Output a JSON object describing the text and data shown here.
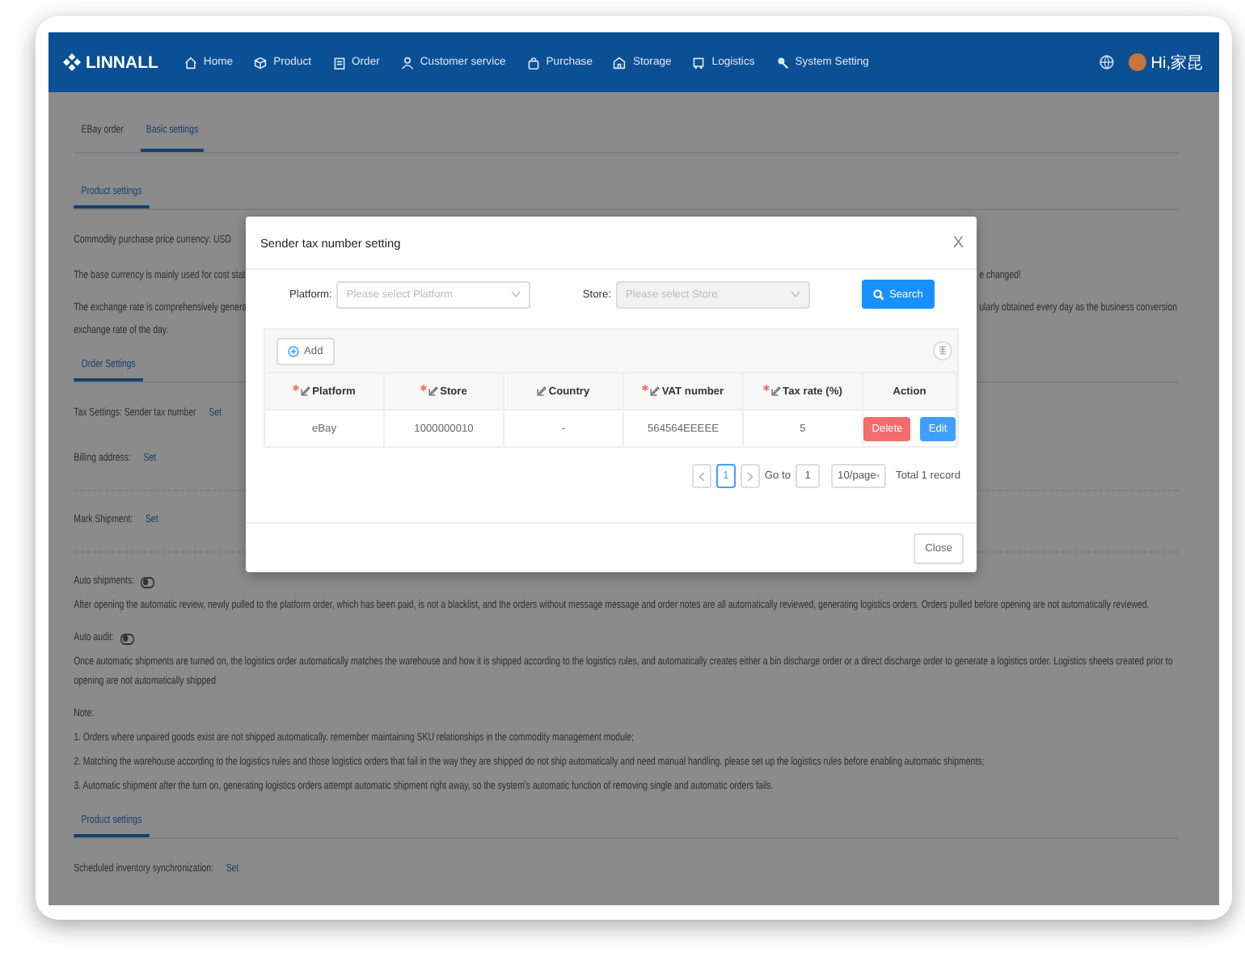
{
  "nav": {
    "logo": "LINNALL",
    "items": [
      {
        "label": "Home"
      },
      {
        "label": "Product"
      },
      {
        "label": "Order"
      },
      {
        "label": "Customer service"
      },
      {
        "label": "Purchase"
      },
      {
        "label": "Storage"
      },
      {
        "label": "Logistics"
      },
      {
        "label": "System Setting"
      }
    ],
    "user": "Hi,家昆"
  },
  "tabs": [
    {
      "label": "EBay order",
      "selected": false
    },
    {
      "label": "Basic settings",
      "selected": true
    }
  ],
  "blocks": [
    {
      "kind": "section",
      "title": "Product settings"
    },
    {
      "kind": "line",
      "left": "Commodity purchase price currency:  USD"
    },
    {
      "kind": "line",
      "left": "The base currency is mainly used for cost stat",
      "right": "e changed!"
    },
    {
      "kind": "line",
      "left": "The exchange rate is comprehensively genera",
      "right": "ularly obtained every day as the business conversion"
    },
    {
      "kind": "line",
      "left": "exchange rate of the day."
    },
    {
      "kind": "section",
      "title": "Order Settings"
    },
    {
      "kind": "setting",
      "label": "Tax Settings:  Sender tax number",
      "link": "Set"
    },
    {
      "kind": "setting",
      "label": "Billing address:",
      "link": "Set"
    },
    {
      "kind": "setting",
      "label": "Mark Shipment:",
      "link": "Set"
    },
    {
      "kind": "toggle",
      "label": "Auto shipments:",
      "on": false,
      "text": "After opening the automatic review, newly pulled to the platform order, which has been paid, is not a blacklist, and the orders without message message and order notes are all automatically reviewed, generating logistics orders. Orders pulled before opening are not automatically reviewed."
    },
    {
      "kind": "toggle",
      "label": "Auto audit:",
      "on": false,
      "text": "Once automatic shipments are turned on, the logistics order automatically matches the warehouse and how it is shipped according to the logistics rules, and automatically creates either a bin discharge order or a direct discharge order to generate a logistics order. Logistics sheets created prior to opening are not automatically shipped"
    },
    {
      "kind": "line",
      "left": "Note:"
    },
    {
      "kind": "line",
      "left": "1. Orders where unpaired goods exist are not shipped automatically. remember maintaining SKU relationships in the commodity management module;"
    },
    {
      "kind": "line",
      "left": "2. Matching the warehouse according to the logistics rules and those logistics orders that fail in the way they are shipped do not ship automatically and need manual handling. please set up the logistics rules before enabling automatic shipments;"
    },
    {
      "kind": "line",
      "left": "3. Automatic shipment after the turn on, generating logistics orders attempt automatic shipment right away, so the system's automatic function of removing single and automatic orders fails."
    },
    {
      "kind": "section",
      "title": "Product settings"
    },
    {
      "kind": "setting",
      "label": "Scheduled inventory synchronization:",
      "link": "Set"
    }
  ],
  "modal": {
    "title": "Sender tax number setting",
    "close": "X",
    "filters": [
      {
        "label": "Platform:",
        "placeholder": "Please select Platform",
        "disabled": false
      },
      {
        "label": "Store:",
        "placeholder": "Please select Store",
        "disabled": true
      }
    ],
    "search_button": "Search",
    "add_button": "Add",
    "columns": [
      {
        "label": "Platform",
        "required": true,
        "editable": true
      },
      {
        "label": "Store",
        "required": true,
        "editable": true
      },
      {
        "label": "Country",
        "required": false,
        "editable": true
      },
      {
        "label": "VAT number",
        "required": true,
        "editable": true
      },
      {
        "label": "Tax rate (%)",
        "required": true,
        "editable": true
      },
      {
        "label": "Action",
        "required": false,
        "editable": false
      }
    ],
    "rows": [
      {
        "cells": [
          "eBay",
          "1000000010",
          "-",
          "564564EEEEE",
          "5"
        ],
        "actions": [
          {
            "label": "Delete",
            "kind": "danger"
          },
          {
            "label": "Edit",
            "kind": "primary"
          }
        ]
      }
    ],
    "pagination": {
      "pages": [
        {
          "label": "1",
          "selected": true
        }
      ],
      "goto_label": "Go to",
      "goto_value": "1",
      "page_size": "10/page",
      "total": "Total 1 record"
    },
    "close_button": "Close"
  }
}
